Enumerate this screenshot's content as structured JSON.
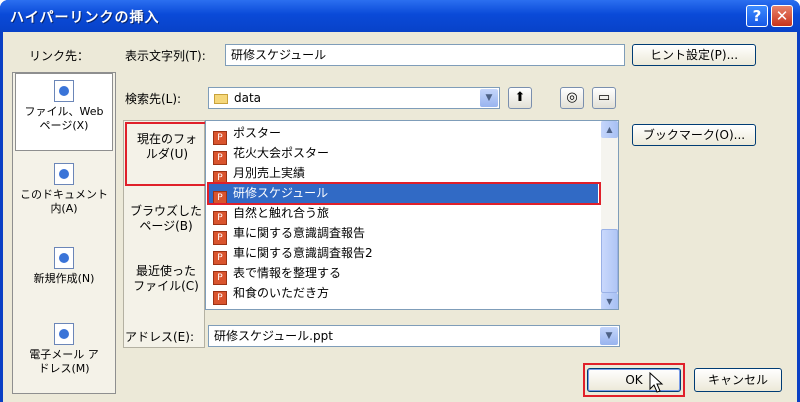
{
  "window": {
    "title": "ハイパーリンクの挿入",
    "help_glyph": "?",
    "close_glyph": "✕"
  },
  "link_to": {
    "label": "リンク先：",
    "items": [
      {
        "line1": "ファイル、Web",
        "line2": "ページ(X)",
        "icon": "document-globe-icon"
      },
      {
        "line1": "このドキュメント",
        "line2": "内(A)",
        "icon": "document-icon"
      },
      {
        "line1": "新規作成(N)",
        "line2": "",
        "icon": "new-document-icon"
      },
      {
        "line1": "電子メール ア",
        "line2": "ドレス(M)",
        "icon": "email-icon"
      }
    ]
  },
  "display_text": {
    "label": "表示文字列(T):",
    "value": "研修スケジュール"
  },
  "screentip_button": "ヒント設定(P)...",
  "look_in": {
    "label": "検索先(L):",
    "value": "data"
  },
  "side_tabs": {
    "current_folder": {
      "line1": "現在のフォ",
      "line2": "ルダ(U)"
    },
    "browsed_pages": {
      "line1": "ブラウズした",
      "line2": "ページ(B)"
    },
    "recent_files": {
      "line1": "最近使った",
      "line2": "ファイル(C)"
    }
  },
  "files": [
    "ポスター",
    "花火大会ポスター",
    "月別売上実績",
    "研修スケジュール",
    "自然と触れ合う旅",
    "車に関する意識調査報告",
    "車に関する意識調査報告2",
    "表で情報を整理する",
    "和食のいただき方"
  ],
  "selected_file_index": 3,
  "bookmark_button": "ブックマーク(O)...",
  "address": {
    "label": "アドレス(E):",
    "value": "研修スケジュール.ppt"
  },
  "ok_button": "OK",
  "cancel_button": "キャンセル",
  "colors": {
    "titlebar": "#0a4ad8",
    "selection": "#316ac5",
    "highlight": "#e0202a",
    "face": "#ece9d8"
  }
}
